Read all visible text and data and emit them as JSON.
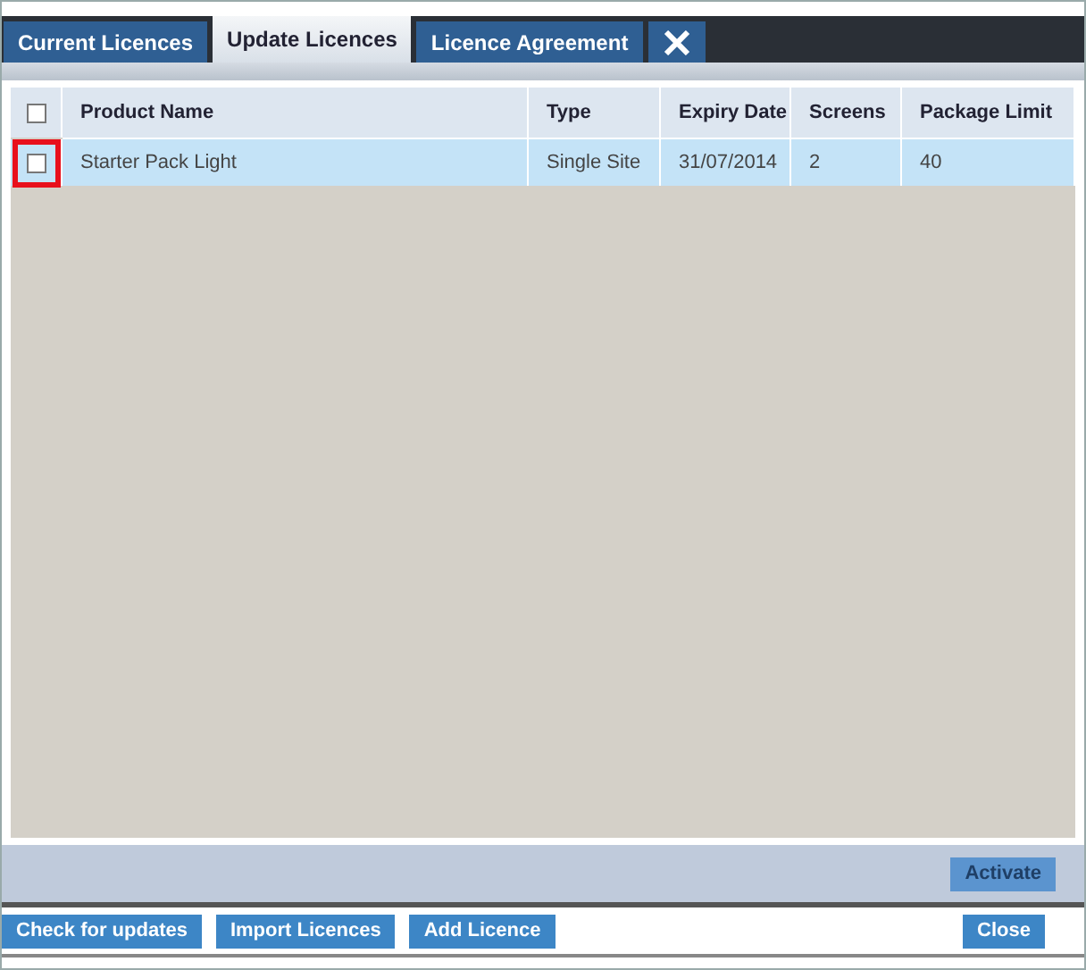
{
  "tabs": [
    {
      "kind": "text",
      "label": "Current Licences",
      "selected": false
    },
    {
      "kind": "text",
      "label": "Update Licences",
      "selected": true
    },
    {
      "kind": "text",
      "label": "Licence Agreement",
      "selected": false
    },
    {
      "kind": "icon",
      "selected": false
    }
  ],
  "table": {
    "select_all": {
      "checked": false
    },
    "columns": [
      "Product Name",
      "Type",
      "Expiry Date",
      "Screens",
      "Package Limit"
    ],
    "rows": [
      {
        "checked": false,
        "highlighted": true,
        "cells": [
          "Starter Pack Light",
          "Single Site",
          "31/07/2014",
          "2",
          "40"
        ]
      }
    ]
  },
  "action_button": {
    "label": "Activate",
    "disabled": true
  },
  "footer_left": [
    "Check for updates",
    "Import Licences",
    "Add Licence"
  ],
  "footer_right": [
    "Close"
  ]
}
